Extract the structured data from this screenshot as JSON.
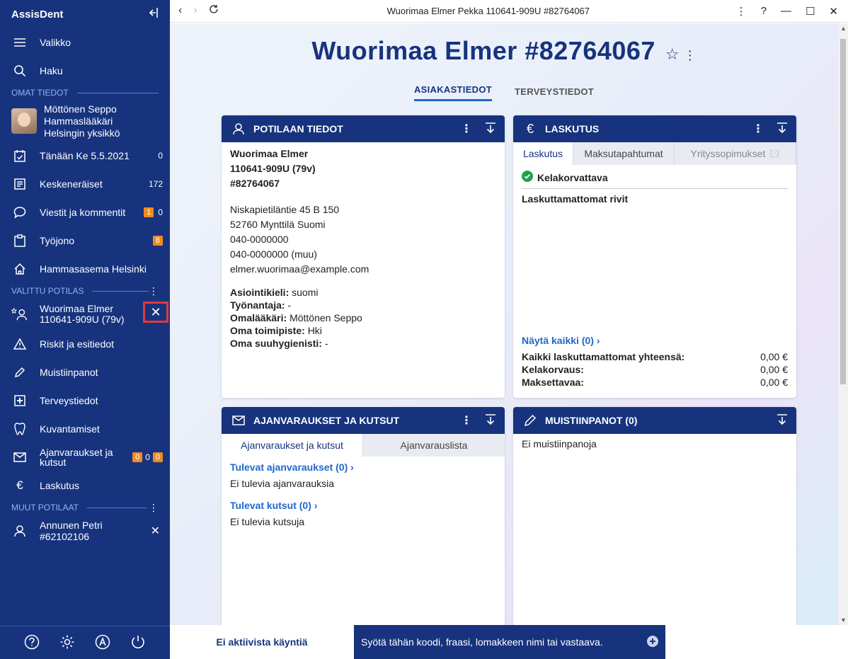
{
  "app": {
    "name": "AssisDent"
  },
  "window": {
    "title": "Wuorimaa Elmer Pekka 110641-909U #82764067"
  },
  "sidebar": {
    "menu_label": "Valikko",
    "search_label": "Haku",
    "own_section": "OMAT TIEDOT",
    "user": {
      "name": "Möttönen Seppo",
      "role": "Hammaslääkäri",
      "unit": "Helsingin yksikkö"
    },
    "items": [
      {
        "label": "Tänään Ke 5.5.2021",
        "count": "0"
      },
      {
        "label": "Keskeneräiset",
        "count": "172"
      },
      {
        "label": "Viestit ja kommentit",
        "badge": "1",
        "count": "0"
      },
      {
        "label": "Työjono",
        "badge": "8"
      },
      {
        "label": "Hammasasema Helsinki"
      }
    ],
    "selected_section": "VALITTU POTILAS",
    "selected_patient": {
      "name": "Wuorimaa Elmer",
      "id": "110641-909U (79v)"
    },
    "patient_items": [
      {
        "label": "Riskit ja esitiedot"
      },
      {
        "label": "Muistiinpanot"
      },
      {
        "label": "Terveystiedot"
      },
      {
        "label": "Kuvantamiset"
      },
      {
        "label": "Ajanvaraukset ja kutsut",
        "badge1": "0",
        "count": "0",
        "badge2": "0"
      },
      {
        "label": "Laskutus"
      }
    ],
    "other_section": "MUUT POTILAAT",
    "other_patient": {
      "name": "Annunen Petri",
      "id": "#62102106"
    }
  },
  "header": {
    "title": "Wuorimaa Elmer #82764067",
    "tabs": [
      "ASIAKASTIEDOT",
      "TERVEYSTIEDOT"
    ]
  },
  "patient_card": {
    "title": "POTILAAN TIEDOT",
    "name": "Wuorimaa Elmer",
    "ssn": "110641-909U (79v)",
    "number": "#82764067",
    "address1": "Niskapietiläntie 45 B 150",
    "address2": "52760 Mynttilä Suomi",
    "phone1": "040-0000000",
    "phone2": "040-0000000 (muu)",
    "email": "elmer.wuorimaa@example.com",
    "fields": [
      {
        "label": "Asiointikieli:",
        "value": "suomi"
      },
      {
        "label": "Työnantaja:",
        "value": "-"
      },
      {
        "label": "Omalääkäri:",
        "value": "Möttönen Seppo"
      },
      {
        "label": "Oma toimipiste:",
        "value": "Hki"
      },
      {
        "label": "Oma suuhygienisti:",
        "value": "-"
      }
    ]
  },
  "billing_card": {
    "title": "LASKUTUS",
    "tabs": [
      "Laskutus",
      "Maksutapahtumat",
      "Yrityssopimukset"
    ],
    "tab3_badge": "0",
    "status": "Kelakorvattava",
    "subtitle": "Laskuttamattomat rivit",
    "show_all": "Näytä kaikki (0)",
    "rows": [
      {
        "label": "Kaikki laskuttamattomat yhteensä:",
        "value": "0,00 €"
      },
      {
        "label": "Kelakorvaus:",
        "value": "0,00 €"
      },
      {
        "label": "Maksettavaa:",
        "value": "0,00 €"
      }
    ]
  },
  "appointments_card": {
    "title": "AJANVARAUKSET JA KUTSUT",
    "tabs": [
      "Ajanvaraukset ja kutsut",
      "Ajanvarauslista"
    ],
    "upcoming_link": "Tulevat ajanvaraukset (0)",
    "upcoming_empty": "Ei tulevia ajanvarauksia",
    "invites_link": "Tulevat kutsut (0)",
    "invites_empty": "Ei tulevia kutsuja"
  },
  "notes_card": {
    "title": "MUISTIINPANOT (0)",
    "empty": "Ei muistiinpanoja"
  },
  "bottombar": {
    "status": "Ei aktiivista käyntiä",
    "placeholder": "Syötä tähän koodi, fraasi, lomakkeen nimi tai vastaava."
  },
  "colors": {
    "navy": "#17337e",
    "accent": "#1e68c9",
    "badge": "#f08c1e",
    "highlight": "#e03a3a"
  }
}
